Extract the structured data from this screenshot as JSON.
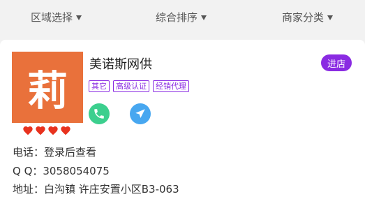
{
  "filters": [
    {
      "label": "区域选择"
    },
    {
      "label": "综合排序"
    },
    {
      "label": "商家分类"
    }
  ],
  "shop": {
    "logo_char": "莉",
    "logo_color": "#e9713b",
    "name": "美诺斯网供",
    "enter_label": "进店",
    "tags": [
      "其它",
      "高级认证",
      "经销代理"
    ],
    "hearts_count": 4,
    "phone_icon": "phone-icon",
    "nav_icon": "navigation-icon",
    "phone_line": "电话：登录后查看",
    "qq_line": "Q Q：3058054075",
    "address_line": "地址：白沟镇 许庄安置小区B3-063"
  },
  "colors": {
    "accent": "#8a2be2",
    "phone": "#3ccf8e",
    "nav": "#47a7f0",
    "heart": "#e8321e"
  }
}
